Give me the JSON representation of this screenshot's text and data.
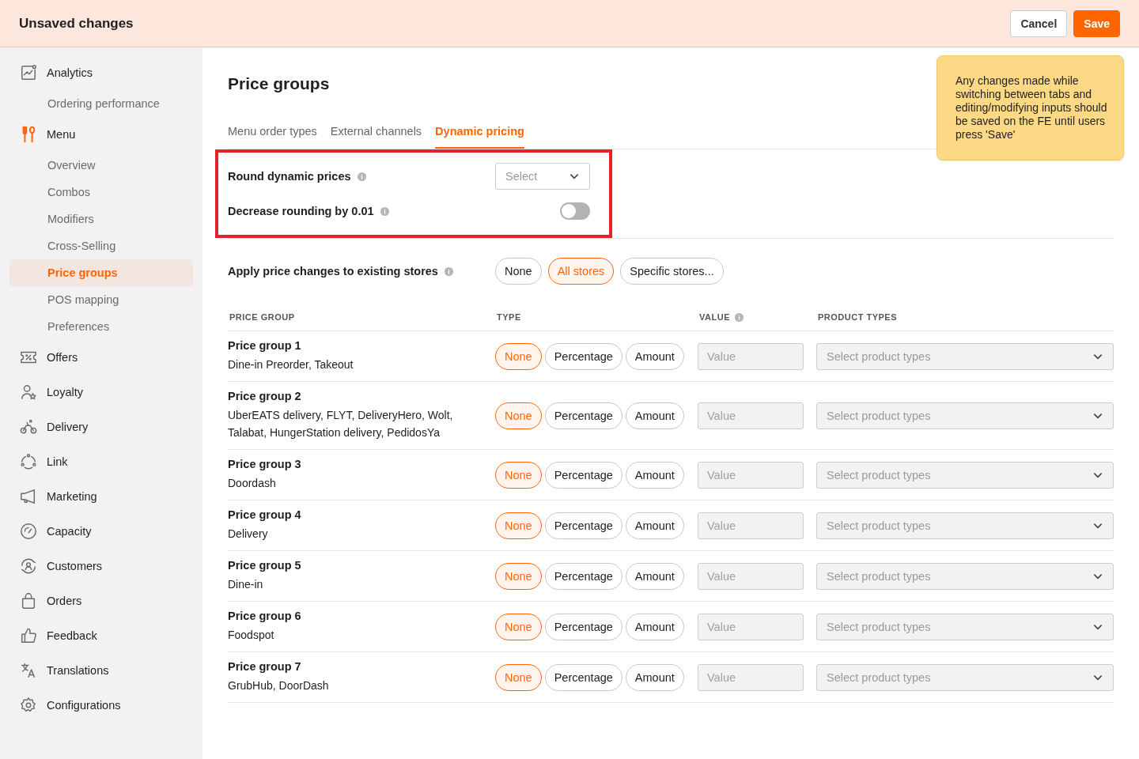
{
  "header": {
    "title": "Unsaved changes",
    "buttons": [
      {
        "label": "Cancel",
        "kind": "secondary"
      },
      {
        "label": "Save",
        "kind": "primary"
      }
    ]
  },
  "sidebar": {
    "items": [
      {
        "label": "Analytics",
        "selected": false,
        "children": [
          {
            "label": "Ordering performance",
            "selected": false
          }
        ]
      },
      {
        "label": "Menu",
        "selected": true,
        "children": [
          {
            "label": "Overview",
            "selected": false
          },
          {
            "label": "Combos",
            "selected": false
          },
          {
            "label": "Modifiers",
            "selected": false
          },
          {
            "label": "Cross-Selling",
            "selected": false
          },
          {
            "label": "Price groups",
            "selected": true
          },
          {
            "label": "POS mapping",
            "selected": false
          },
          {
            "label": "Preferences",
            "selected": false
          }
        ]
      },
      {
        "label": "Offers",
        "selected": false
      },
      {
        "label": "Loyalty",
        "selected": false
      },
      {
        "label": "Delivery",
        "selected": false
      },
      {
        "label": "Link",
        "selected": false
      },
      {
        "label": "Marketing",
        "selected": false
      },
      {
        "label": "Capacity",
        "selected": false
      },
      {
        "label": "Customers",
        "selected": false
      },
      {
        "label": "Orders",
        "selected": false
      },
      {
        "label": "Feedback",
        "selected": false
      },
      {
        "label": "Translations",
        "selected": false
      },
      {
        "label": "Configurations",
        "selected": false
      }
    ]
  },
  "page": {
    "title": "Price groups",
    "tabs": [
      {
        "label": "Menu order types",
        "selected": false
      },
      {
        "label": "External channels",
        "selected": false
      },
      {
        "label": "Dynamic pricing",
        "selected": true
      }
    ],
    "settings": [
      {
        "kind": "select",
        "label": "Round dynamic prices",
        "placeholder": "Select"
      },
      {
        "kind": "toggle",
        "label": "Decrease rounding by 0.01",
        "on": false
      }
    ],
    "apply": {
      "label": "Apply price changes to existing stores",
      "options": [
        {
          "label": "None",
          "selected": false
        },
        {
          "label": "All stores",
          "selected": true
        },
        {
          "label": "Specific stores...",
          "selected": false
        }
      ]
    },
    "table": {
      "columns": [
        "PRICE GROUP",
        "TYPE",
        "VALUE",
        "PRODUCT TYPES"
      ],
      "rows": [
        {
          "name": "Price group 1",
          "channels": "Dine-in Preorder, Takeout",
          "types": [
            {
              "label": "None",
              "selected": true
            },
            {
              "label": "Percentage",
              "selected": false
            },
            {
              "label": "Amount",
              "selected": false
            }
          ],
          "value_placeholder": "Value",
          "product_placeholder": "Select product types"
        },
        {
          "name": "Price group 2",
          "channels": "UberEATS delivery, FLYT, DeliveryHero, Wolt, Talabat, HungerStation delivery, PedidosYa",
          "types": [
            {
              "label": "None",
              "selected": true
            },
            {
              "label": "Percentage",
              "selected": false
            },
            {
              "label": "Amount",
              "selected": false
            }
          ],
          "value_placeholder": "Value",
          "product_placeholder": "Select product types"
        },
        {
          "name": "Price group 3",
          "channels": "Doordash",
          "types": [
            {
              "label": "None",
              "selected": true
            },
            {
              "label": "Percentage",
              "selected": false
            },
            {
              "label": "Amount",
              "selected": false
            }
          ],
          "value_placeholder": "Value",
          "product_placeholder": "Select product types"
        },
        {
          "name": "Price group 4",
          "channels": "Delivery",
          "types": [
            {
              "label": "None",
              "selected": true
            },
            {
              "label": "Percentage",
              "selected": false
            },
            {
              "label": "Amount",
              "selected": false
            }
          ],
          "value_placeholder": "Value",
          "product_placeholder": "Select product types"
        },
        {
          "name": "Price group 5",
          "channels": "Dine-in",
          "types": [
            {
              "label": "None",
              "selected": true
            },
            {
              "label": "Percentage",
              "selected": false
            },
            {
              "label": "Amount",
              "selected": false
            }
          ],
          "value_placeholder": "Value",
          "product_placeholder": "Select product types"
        },
        {
          "name": "Price group 6",
          "channels": "Foodspot",
          "types": [
            {
              "label": "None",
              "selected": true
            },
            {
              "label": "Percentage",
              "selected": false
            },
            {
              "label": "Amount",
              "selected": false
            }
          ],
          "value_placeholder": "Value",
          "product_placeholder": "Select product types"
        },
        {
          "name": "Price group 7",
          "channels": "GrubHub, DoorDash",
          "types": [
            {
              "label": "None",
              "selected": true
            },
            {
              "label": "Percentage",
              "selected": false
            },
            {
              "label": "Amount",
              "selected": false
            }
          ],
          "value_placeholder": "Value",
          "product_placeholder": "Select product types"
        }
      ]
    }
  },
  "note": {
    "text": "Any changes made while switching between tabs and editing/modifying inputs should be saved on the FE until users press 'Save'"
  }
}
